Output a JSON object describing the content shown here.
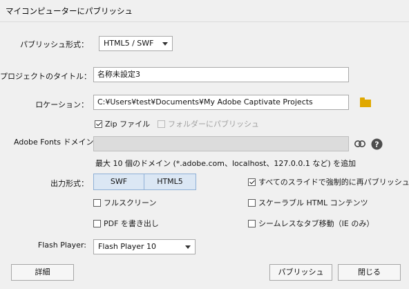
{
  "window": {
    "title": "マイコンピューターにパブリッシュ"
  },
  "publish_format": {
    "label": "パブリッシュ形式：",
    "value": "HTML5 / SWF"
  },
  "project_title": {
    "label": "プロジェクトのタイトル：",
    "value": "名称未設定3"
  },
  "location": {
    "label": "ロケーション：",
    "value": "C:¥Users¥test¥Documents¥My Adobe Captivate Projects"
  },
  "zip": {
    "label": "Zip ファイル",
    "checked": true
  },
  "folder_publish": {
    "label": "フォルダーにパブリッシュ",
    "checked": false,
    "disabled": true
  },
  "adobe_fonts": {
    "label": "Adobe Fonts ドメイン：",
    "value": ""
  },
  "domain_hint": "最大 10 個のドメイン (*.adobe.com、localhost、127.0.0.1 など) を追加",
  "output_format": {
    "label": "出力形式：",
    "options": [
      "SWF",
      "HTML5"
    ]
  },
  "options": {
    "force_republish": {
      "label": "すべてのスライドで強制的に再パブリッシュする",
      "checked": true
    },
    "fullscreen": {
      "label": "フルスクリーン",
      "checked": false
    },
    "scalable_html": {
      "label": "スケーラブル HTML コンテンツ",
      "checked": false
    },
    "pdf_export": {
      "label": "PDF を書き出し",
      "checked": false
    },
    "seamless_tab": {
      "label": "シームレスなタブ移動（IE のみ）",
      "checked": false
    }
  },
  "flash_player": {
    "label": "Flash Player:",
    "value": "Flash Player 10"
  },
  "buttons": {
    "details": "詳細",
    "publish": "パブリッシュ",
    "close": "閉じる"
  }
}
